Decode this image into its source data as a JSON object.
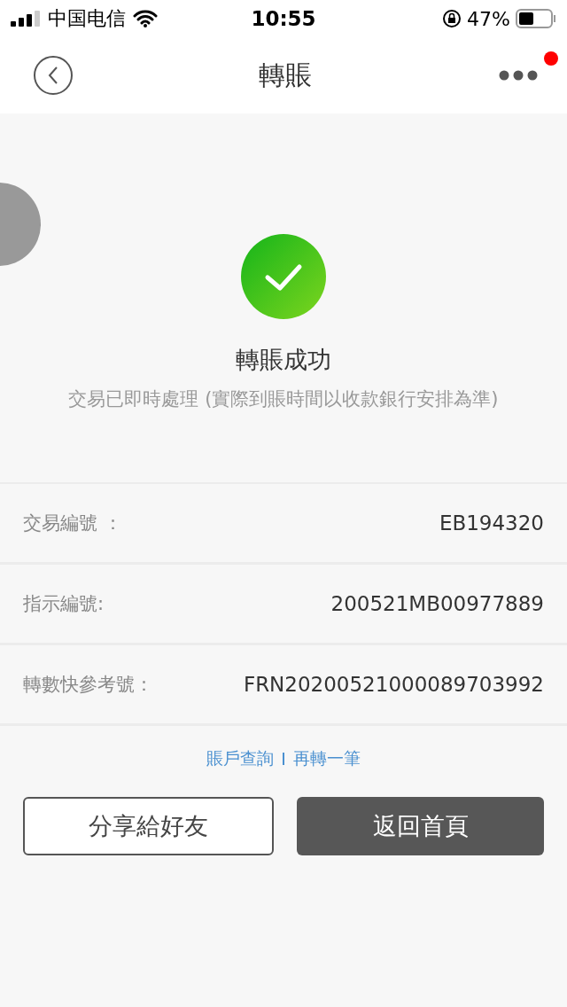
{
  "status_bar": {
    "carrier": "中国电信",
    "time": "10:55",
    "battery": "47%"
  },
  "nav": {
    "title": "轉賬",
    "has_notification": true
  },
  "result": {
    "title": "轉賬成功",
    "message": "交易已即時處理 (實際到賬時間以收款銀行安排為準)"
  },
  "details": [
    {
      "label": "交易編號 ：",
      "value": "EB194320"
    },
    {
      "label": "指示編號:",
      "value": "200521MB00977889"
    },
    {
      "label": "轉數快參考號：",
      "value": "FRN20200521000089703992"
    }
  ],
  "links": [
    "賬戶查詢",
    "再轉一筆"
  ],
  "buttons": [
    {
      "label": "分享給好友",
      "kind": "outline"
    },
    {
      "label": "返回首頁",
      "kind": "filled"
    }
  ]
}
